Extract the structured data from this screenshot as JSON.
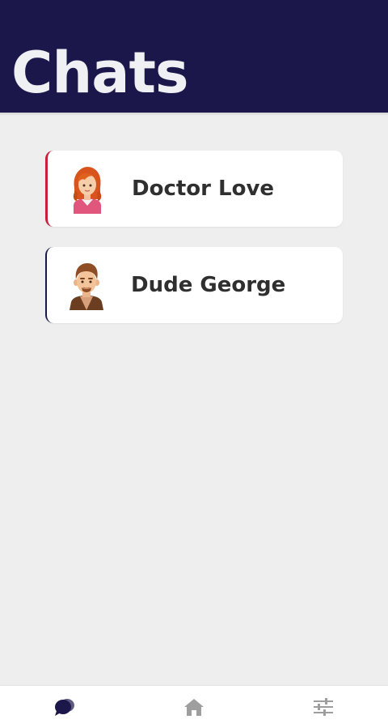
{
  "header": {
    "title": "Chats"
  },
  "chats": [
    {
      "name": "Doctor Love",
      "avatar_icon": "woman-avatar-icon",
      "accent": "#c81e3a"
    },
    {
      "name": "Dude George",
      "avatar_icon": "man-avatar-icon",
      "accent": "#1b174a"
    }
  ],
  "nav": {
    "items": [
      {
        "icon": "chat-bubbles-icon",
        "active": true
      },
      {
        "icon": "home-icon",
        "active": false
      },
      {
        "icon": "settings-sliders-icon",
        "active": false
      }
    ]
  },
  "colors": {
    "header_bg": "#1b174a",
    "page_bg": "#eeeeee",
    "nav_active": "#1b174a",
    "nav_inactive": "#9e9e9e"
  }
}
